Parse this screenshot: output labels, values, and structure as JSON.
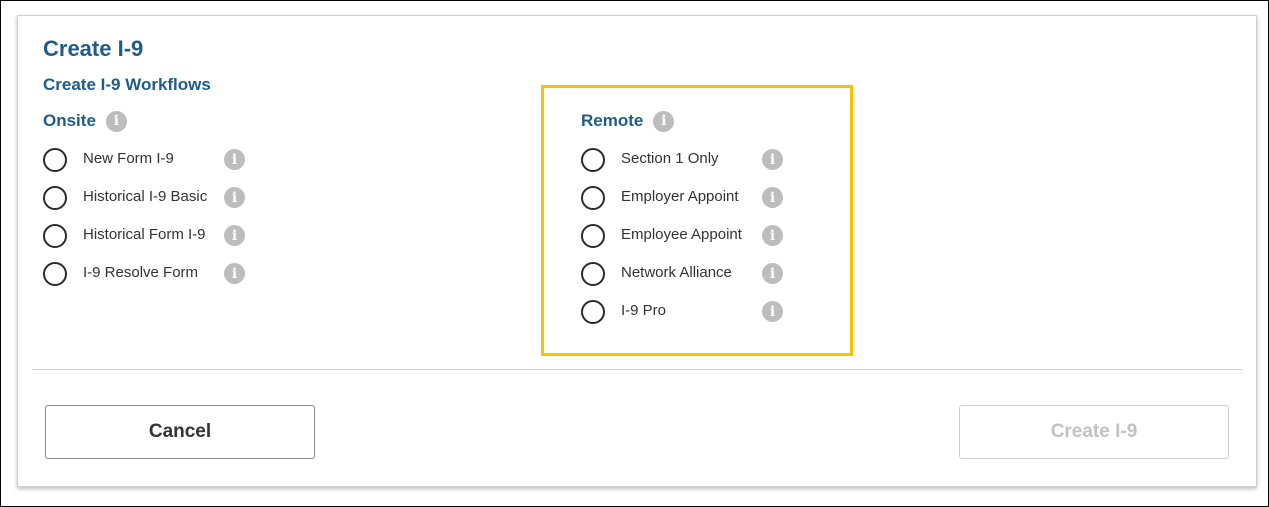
{
  "dialog": {
    "title": "Create I-9",
    "subtitle": "Create I-9 Workflows"
  },
  "onsite": {
    "heading": "Onsite",
    "options": [
      {
        "label": "New Form I-9",
        "selected": false
      },
      {
        "label": "Historical I-9 Basic",
        "selected": false
      },
      {
        "label": "Historical Form I-9",
        "selected": false
      },
      {
        "label": "I-9 Resolve Form",
        "selected": false
      }
    ]
  },
  "remote": {
    "heading": "Remote",
    "highlight_color": "#f5c400",
    "options": [
      {
        "label": "Section 1 Only",
        "selected": false
      },
      {
        "label": "Employer Appoint",
        "selected": false
      },
      {
        "label": "Employee Appoint",
        "selected": false
      },
      {
        "label": "Network Alliance",
        "selected": false
      },
      {
        "label": "I-9 Pro",
        "selected": false
      }
    ]
  },
  "icons": {
    "info": "i"
  },
  "footer": {
    "cancel_label": "Cancel",
    "create_label": "Create I-9",
    "create_disabled": true
  },
  "colors": {
    "heading": "#1f5c87",
    "info_icon": "#bdbdbd"
  }
}
